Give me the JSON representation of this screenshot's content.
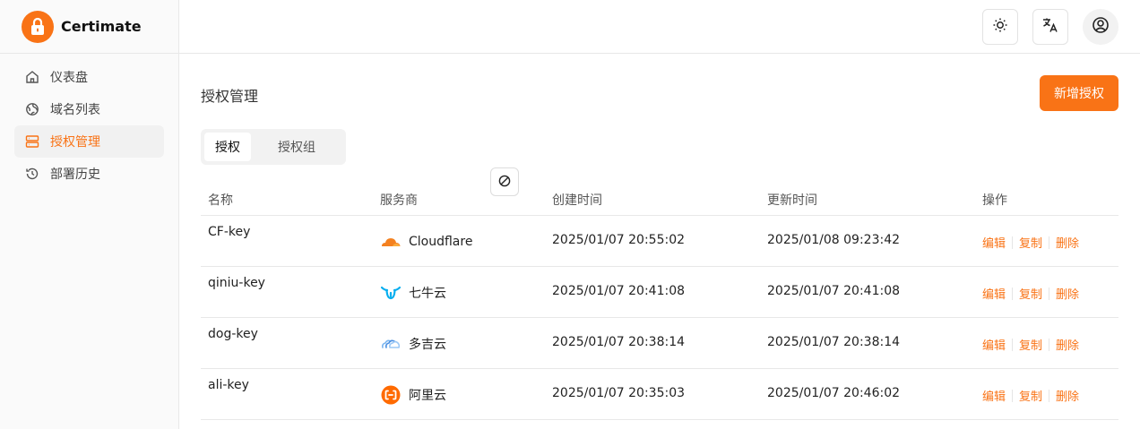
{
  "app": {
    "name": "Certimate",
    "accent": "#f97316"
  },
  "sidebar": {
    "items": [
      {
        "label": "仪表盘",
        "icon": "home-icon",
        "active": false
      },
      {
        "label": "域名列表",
        "icon": "globe-icon",
        "active": false
      },
      {
        "label": "授权管理",
        "icon": "server-icon",
        "active": true
      },
      {
        "label": "部署历史",
        "icon": "history-icon",
        "active": false
      }
    ]
  },
  "header": {
    "buttons": [
      {
        "icon": "sun-icon"
      },
      {
        "icon": "translate-icon"
      },
      {
        "icon": "user-circle-icon"
      }
    ]
  },
  "main": {
    "title": "授权管理",
    "add_button": "新增授权",
    "tabs": [
      {
        "label": "授权",
        "active": true
      },
      {
        "label": "授权组",
        "active": false
      }
    ],
    "table": {
      "columns": [
        "名称",
        "服务商",
        "创建时间",
        "更新时间",
        "操作"
      ],
      "rows": [
        {
          "name": "CF-key",
          "provider": "Cloudflare",
          "provider_icon": "cloudflare-icon",
          "created": "2025/01/07 20:55:02",
          "updated": "2025/01/08 09:23:42"
        },
        {
          "name": "qiniu-key",
          "provider": "七牛云",
          "provider_icon": "qiniu-icon",
          "created": "2025/01/07 20:41:08",
          "updated": "2025/01/07 20:41:08"
        },
        {
          "name": "dog-key",
          "provider": "多吉云",
          "provider_icon": "dogecloud-icon",
          "created": "2025/01/07 20:38:14",
          "updated": "2025/01/07 20:38:14"
        },
        {
          "name": "ali-key",
          "provider": "阿里云",
          "provider_icon": "aliyun-icon",
          "created": "2025/01/07 20:35:03",
          "updated": "2025/01/07 20:46:02"
        }
      ],
      "actions": {
        "edit": "编辑",
        "copy": "复制",
        "delete": "删除"
      }
    }
  }
}
